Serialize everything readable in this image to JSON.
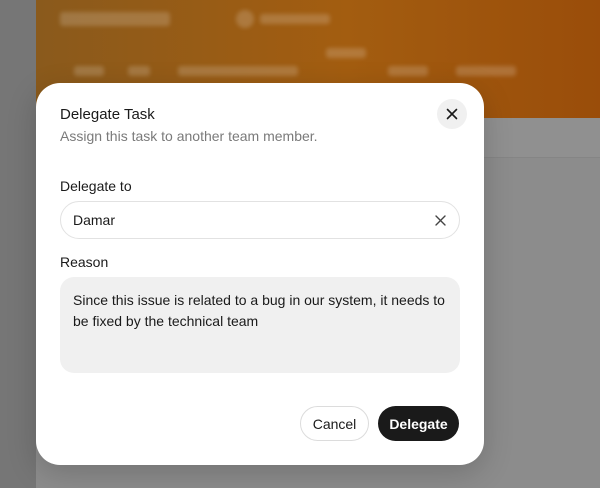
{
  "modal": {
    "title": "Delegate Task",
    "subtitle": "Assign this task to another team member.",
    "close_icon": "close-icon"
  },
  "delegate_field": {
    "label": "Delegate to",
    "value": "Damar",
    "clear_icon": "clear-icon"
  },
  "reason_field": {
    "label": "Reason",
    "value": "Since this issue is related to a bug in our system, it needs to be fixed by the technical team"
  },
  "actions": {
    "cancel_label": "Cancel",
    "delegate_label": "Delegate"
  },
  "colors": {
    "primary_button": "#1a1a1a",
    "header_accent": "#a35d10",
    "overlay": "#8a8a8a"
  }
}
